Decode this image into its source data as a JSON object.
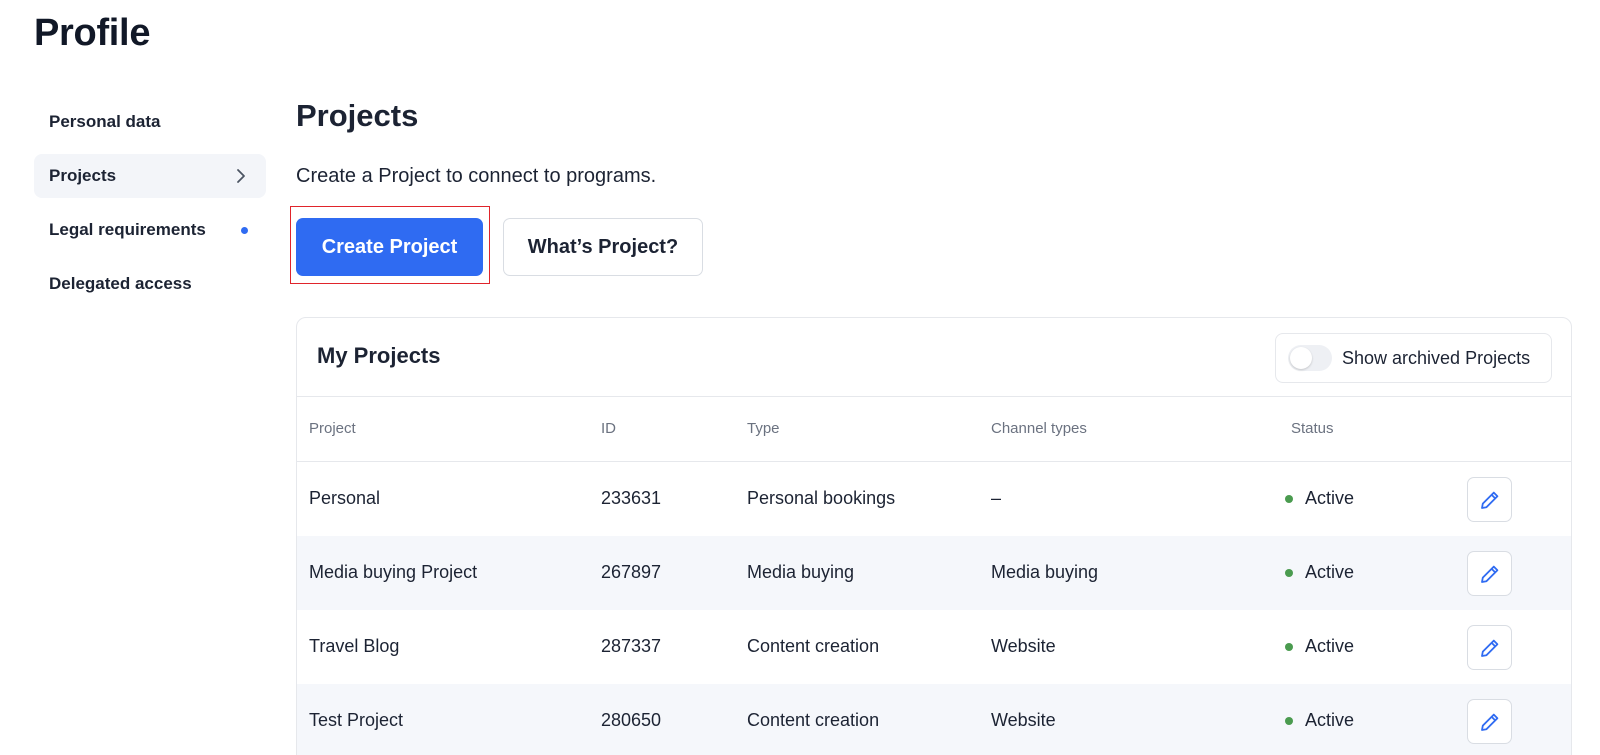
{
  "page": {
    "title": "Profile"
  },
  "sidebar": {
    "items": [
      {
        "label": "Personal data"
      },
      {
        "label": "Projects"
      },
      {
        "label": "Legal requirements"
      },
      {
        "label": "Delegated access"
      }
    ]
  },
  "projects": {
    "title": "Projects",
    "description": "Create a Project to connect to programs.",
    "create_label": "Create Project",
    "whats_label": "What’s Project?"
  },
  "my_projects": {
    "title": "My Projects",
    "show_archived_label": "Show archived Projects",
    "show_archived_enabled": false,
    "columns": {
      "project": "Project",
      "id": "ID",
      "type": "Type",
      "channel": "Channel types",
      "status": "Status"
    },
    "rows": [
      {
        "project": "Personal",
        "id": "233631",
        "type": "Personal bookings",
        "channel": "–",
        "status": "Active"
      },
      {
        "project": "Media buying Project",
        "id": "267897",
        "type": "Media buying",
        "channel": "Media buying",
        "status": "Active"
      },
      {
        "project": "Travel Blog",
        "id": "287337",
        "type": "Content creation",
        "channel": "Website",
        "status": "Active"
      },
      {
        "project": "Test Project",
        "id": "280650",
        "type": "Content creation",
        "channel": "Website",
        "status": "Active"
      }
    ]
  },
  "colors": {
    "accent": "#2f6bf2",
    "status_active": "#4a9b4f",
    "highlight": "#e0242b"
  }
}
